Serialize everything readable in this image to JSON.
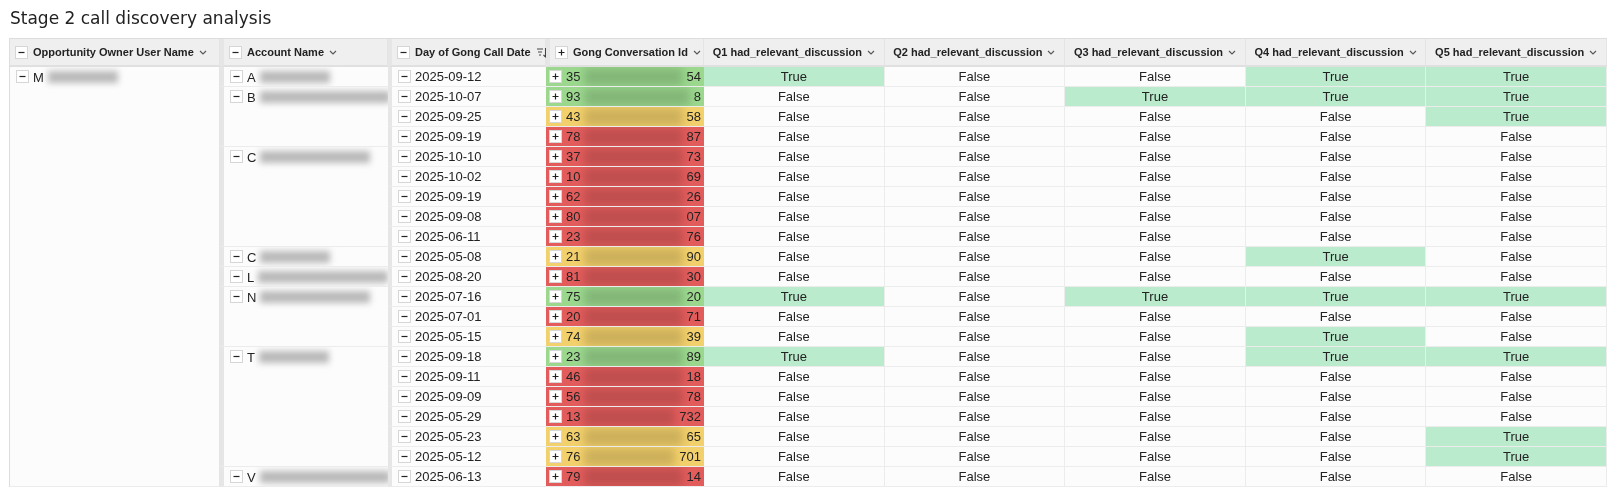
{
  "title": "Stage 2 call discovery analysis",
  "columns": [
    {
      "label": "Opportunity Owner User Name",
      "expanded": true,
      "sorted": false
    },
    {
      "label": "Account Name",
      "expanded": true,
      "sorted": false
    },
    {
      "label": "Day of Gong Call Date",
      "expanded": true,
      "sorted": true
    },
    {
      "label": "Gong Conversation Id",
      "expanded": false,
      "sorted": false
    },
    {
      "label": "Q1 had_relevant_discussion",
      "sorted": false
    },
    {
      "label": "Q2 had_relevant_discussion",
      "sorted": false
    },
    {
      "label": "Q3 had_relevant_discussion",
      "sorted": false
    },
    {
      "label": "Q4 had_relevant_discussion",
      "sorted": false
    },
    {
      "label": "Q5 had_relevant_discussion",
      "sorted": false
    }
  ],
  "owners": [
    {
      "name": "M",
      "children": [
        {
          "name": "A",
          "children": [
            {
              "date": "2025-09-12",
              "id_start": "35",
              "id_end": "54",
              "color": "#9bd88e",
              "answers": [
                {
                  "text": "True",
                  "highlighted": true
                },
                {
                  "text": "False",
                  "highlighted": false
                },
                {
                  "text": "False",
                  "highlighted": false
                },
                {
                  "text": "True",
                  "highlighted": true
                },
                {
                  "text": "True",
                  "highlighted": true
                }
              ]
            }
          ]
        },
        {
          "name": "B",
          "children": [
            {
              "date": "2025-10-07",
              "id_start": "93",
              "id_end": "8",
              "color": "#9bd88e",
              "answers": [
                {
                  "text": "False",
                  "highlighted": false
                },
                {
                  "text": "False",
                  "highlighted": false
                },
                {
                  "text": "True",
                  "highlighted": true
                },
                {
                  "text": "True",
                  "highlighted": true
                },
                {
                  "text": "True",
                  "highlighted": true
                }
              ]
            },
            {
              "date": "2025-09-25",
              "id_start": "43",
              "id_end": "58",
              "color": "#f2d06b",
              "answers": [
                {
                  "text": "False",
                  "highlighted": false
                },
                {
                  "text": "False",
                  "highlighted": false
                },
                {
                  "text": "False",
                  "highlighted": false
                },
                {
                  "text": "False",
                  "highlighted": false
                },
                {
                  "text": "True",
                  "highlighted": true
                }
              ]
            },
            {
              "date": "2025-09-19",
              "id_start": "78",
              "id_end": "87",
              "color": "#e35c5c",
              "answers": [
                {
                  "text": "False",
                  "highlighted": false
                },
                {
                  "text": "False",
                  "highlighted": false
                },
                {
                  "text": "False",
                  "highlighted": false
                },
                {
                  "text": "False",
                  "highlighted": false
                },
                {
                  "text": "False",
                  "highlighted": false
                }
              ]
            }
          ]
        },
        {
          "name": "C",
          "children": [
            {
              "date": "2025-10-10",
              "id_start": "37",
              "id_end": "73",
              "color": "#e35c5c",
              "answers": [
                {
                  "text": "False",
                  "highlighted": false
                },
                {
                  "text": "False",
                  "highlighted": false
                },
                {
                  "text": "False",
                  "highlighted": false
                },
                {
                  "text": "False",
                  "highlighted": false
                },
                {
                  "text": "False",
                  "highlighted": false
                }
              ]
            },
            {
              "date": "2025-10-02",
              "id_start": "10",
              "id_end": "69",
              "color": "#e35c5c",
              "answers": [
                {
                  "text": "False",
                  "highlighted": false
                },
                {
                  "text": "False",
                  "highlighted": false
                },
                {
                  "text": "False",
                  "highlighted": false
                },
                {
                  "text": "False",
                  "highlighted": false
                },
                {
                  "text": "False",
                  "highlighted": false
                }
              ]
            },
            {
              "date": "2025-09-19",
              "id_start": "62",
              "id_end": "26",
              "color": "#e35c5c",
              "answers": [
                {
                  "text": "False",
                  "highlighted": false
                },
                {
                  "text": "False",
                  "highlighted": false
                },
                {
                  "text": "False",
                  "highlighted": false
                },
                {
                  "text": "False",
                  "highlighted": false
                },
                {
                  "text": "False",
                  "highlighted": false
                }
              ]
            },
            {
              "date": "2025-09-08",
              "id_start": "80",
              "id_end": "07",
              "color": "#e35c5c",
              "answers": [
                {
                  "text": "False",
                  "highlighted": false
                },
                {
                  "text": "False",
                  "highlighted": false
                },
                {
                  "text": "False",
                  "highlighted": false
                },
                {
                  "text": "False",
                  "highlighted": false
                },
                {
                  "text": "False",
                  "highlighted": false
                }
              ]
            },
            {
              "date": "2025-06-11",
              "id_start": "23",
              "id_end": "76",
              "color": "#e35c5c",
              "answers": [
                {
                  "text": "False",
                  "highlighted": false
                },
                {
                  "text": "False",
                  "highlighted": false
                },
                {
                  "text": "False",
                  "highlighted": false
                },
                {
                  "text": "False",
                  "highlighted": false
                },
                {
                  "text": "False",
                  "highlighted": false
                }
              ]
            }
          ]
        },
        {
          "name": "C",
          "children": [
            {
              "date": "2025-05-08",
              "id_start": "21",
              "id_end": "90",
              "color": "#f2d06b",
              "answers": [
                {
                  "text": "False",
                  "highlighted": false
                },
                {
                  "text": "False",
                  "highlighted": false
                },
                {
                  "text": "False",
                  "highlighted": false
                },
                {
                  "text": "True",
                  "highlighted": true
                },
                {
                  "text": "False",
                  "highlighted": false
                }
              ]
            }
          ]
        },
        {
          "name": "L",
          "children": [
            {
              "date": "2025-08-20",
              "id_start": "81",
              "id_end": "30",
              "color": "#e35c5c",
              "answers": [
                {
                  "text": "False",
                  "highlighted": false
                },
                {
                  "text": "False",
                  "highlighted": false
                },
                {
                  "text": "False",
                  "highlighted": false
                },
                {
                  "text": "False",
                  "highlighted": false
                },
                {
                  "text": "False",
                  "highlighted": false
                }
              ]
            }
          ]
        },
        {
          "name": "N",
          "children": [
            {
              "date": "2025-07-16",
              "id_start": "75",
              "id_end": "20",
              "color": "#9bd88e",
              "answers": [
                {
                  "text": "True",
                  "highlighted": true
                },
                {
                  "text": "False",
                  "highlighted": false
                },
                {
                  "text": "True",
                  "highlighted": true
                },
                {
                  "text": "True",
                  "highlighted": true
                },
                {
                  "text": "True",
                  "highlighted": true
                }
              ]
            },
            {
              "date": "2025-07-01",
              "id_start": "20",
              "id_end": "71",
              "color": "#e35c5c",
              "answers": [
                {
                  "text": "False",
                  "highlighted": false
                },
                {
                  "text": "False",
                  "highlighted": false
                },
                {
                  "text": "False",
                  "highlighted": false
                },
                {
                  "text": "False",
                  "highlighted": false
                },
                {
                  "text": "False",
                  "highlighted": false
                }
              ]
            },
            {
              "date": "2025-05-15",
              "id_start": "74",
              "id_end": "39",
              "color": "#f2d06b",
              "answers": [
                {
                  "text": "False",
                  "highlighted": false
                },
                {
                  "text": "False",
                  "highlighted": false
                },
                {
                  "text": "False",
                  "highlighted": false
                },
                {
                  "text": "True",
                  "highlighted": true
                },
                {
                  "text": "False",
                  "highlighted": false
                }
              ]
            }
          ]
        },
        {
          "name": "T",
          "children": [
            {
              "date": "2025-09-18",
              "id_start": "23",
              "id_end": "89",
              "color": "#9bd88e",
              "answers": [
                {
                  "text": "True",
                  "highlighted": true
                },
                {
                  "text": "False",
                  "highlighted": false
                },
                {
                  "text": "False",
                  "highlighted": false
                },
                {
                  "text": "True",
                  "highlighted": true
                },
                {
                  "text": "True",
                  "highlighted": true
                }
              ]
            },
            {
              "date": "2025-09-11",
              "id_start": "46",
              "id_end": "18",
              "color": "#e35c5c",
              "answers": [
                {
                  "text": "False",
                  "highlighted": false
                },
                {
                  "text": "False",
                  "highlighted": false
                },
                {
                  "text": "False",
                  "highlighted": false
                },
                {
                  "text": "False",
                  "highlighted": false
                },
                {
                  "text": "False",
                  "highlighted": false
                }
              ]
            },
            {
              "date": "2025-09-09",
              "id_start": "56",
              "id_end": "78",
              "color": "#e35c5c",
              "answers": [
                {
                  "text": "False",
                  "highlighted": false
                },
                {
                  "text": "False",
                  "highlighted": false
                },
                {
                  "text": "False",
                  "highlighted": false
                },
                {
                  "text": "False",
                  "highlighted": false
                },
                {
                  "text": "False",
                  "highlighted": false
                }
              ]
            },
            {
              "date": "2025-05-29",
              "id_start": "13",
              "id_end": "732",
              "color": "#e35c5c",
              "answers": [
                {
                  "text": "False",
                  "highlighted": false
                },
                {
                  "text": "False",
                  "highlighted": false
                },
                {
                  "text": "False",
                  "highlighted": false
                },
                {
                  "text": "False",
                  "highlighted": false
                },
                {
                  "text": "False",
                  "highlighted": false
                }
              ]
            },
            {
              "date": "2025-05-23",
              "id_start": "63",
              "id_end": "65",
              "color": "#f2d06b",
              "answers": [
                {
                  "text": "False",
                  "highlighted": false
                },
                {
                  "text": "False",
                  "highlighted": false
                },
                {
                  "text": "False",
                  "highlighted": false
                },
                {
                  "text": "False",
                  "highlighted": false
                },
                {
                  "text": "True",
                  "highlighted": true
                }
              ]
            },
            {
              "date": "2025-05-12",
              "id_start": "76",
              "id_end": "701",
              "color": "#f2d06b",
              "answers": [
                {
                  "text": "False",
                  "highlighted": false
                },
                {
                  "text": "False",
                  "highlighted": false
                },
                {
                  "text": "False",
                  "highlighted": false
                },
                {
                  "text": "False",
                  "highlighted": false
                },
                {
                  "text": "True",
                  "highlighted": true
                }
              ]
            }
          ]
        },
        {
          "name": "V",
          "children": [
            {
              "date": "2025-06-13",
              "id_start": "79",
              "id_end": "14",
              "color": "#e35c5c",
              "answers": [
                {
                  "text": "False",
                  "highlighted": false
                },
                {
                  "text": "False",
                  "highlighted": false
                },
                {
                  "text": "False",
                  "highlighted": false
                },
                {
                  "text": "False",
                  "highlighted": false
                },
                {
                  "text": "False",
                  "highlighted": false
                }
              ]
            }
          ]
        }
      ]
    }
  ]
}
